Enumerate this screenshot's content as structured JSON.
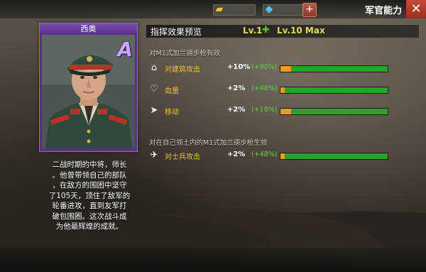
{
  "top_bar": {
    "gold_icon": "gold-bar-icon",
    "gem_icon": "diamond-icon",
    "title": "军官能力",
    "close_symbol": "✕",
    "plus_symbol": "+"
  },
  "officer": {
    "name": "西奥",
    "grade": "A",
    "bio_lines": [
      "二战时期的中将，师长",
      "。他曾带领自己的部队",
      "，在敌方的围困中坚守",
      "了105天，顶住了敌军的",
      "轮番进攻，直到友军打",
      "破包围圈。这次战斗成",
      "为他最辉煌的成就。"
    ]
  },
  "panel": {
    "title": "指挥效果预览",
    "level_current": "Lv.1",
    "level_max": "Lv.10 Max",
    "sections": [
      {
        "title": "对M1式加兰德步枪有效",
        "rows": [
          {
            "icon": "building-attack-icon",
            "label": "对建筑攻击",
            "value": "+10%",
            "bonus": "(+90%)",
            "current_fraction": 0.1
          },
          {
            "icon": "heart-icon",
            "label": "血量",
            "value": "+2%",
            "bonus": "(+48%)",
            "current_fraction": 0.04
          },
          {
            "icon": "boot-icon",
            "label": "移动",
            "value": "+2%",
            "bonus": "(+18%)",
            "current_fraction": 0.1
          }
        ]
      },
      {
        "title": "对在自己领土内的M1式加兰德步枪生效",
        "rows": [
          {
            "icon": "soldier-attack-icon",
            "label": "对士兵攻击",
            "value": "+2%",
            "bonus": "(+48%)",
            "current_fraction": 0.04
          }
        ]
      }
    ]
  },
  "colors": {
    "accent_gold": "#f0c040",
    "bonus_green": "#5fd24a",
    "bar_green": "#2aa12e",
    "bar_orange": "#f09a20",
    "card_purple": "#5a2f86",
    "close_red": "#c74b34"
  }
}
